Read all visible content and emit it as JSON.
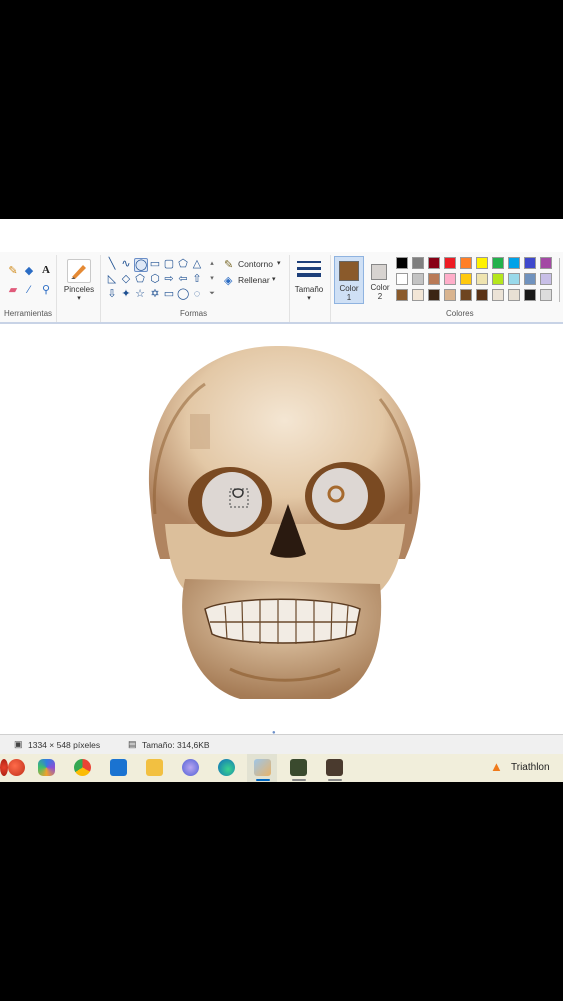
{
  "ribbon": {
    "groups": {
      "tools": "Herramientas",
      "shapes": "Formas",
      "colors": "Colores"
    },
    "brushes_label": "Pinceles",
    "outline_label": "Contorno",
    "fill_label": "Rellenar",
    "size_label": "Tamaño",
    "color1_label": "Color",
    "color1_num": "1",
    "color2_label": "Color",
    "color2_num": "2",
    "text_tool": "A",
    "color1_value": "#8a5a2b",
    "color2_value": "#d7d3d0"
  },
  "palette": {
    "row1": [
      "#000000",
      "#7f7f7f",
      "#880015",
      "#ed1c24",
      "#ff7f27",
      "#fff200",
      "#22b14c",
      "#00a2e8",
      "#3f48cc",
      "#a349a4"
    ],
    "row2": [
      "#ffffff",
      "#c3c3c3",
      "#b97a57",
      "#ffaec9",
      "#ffc90e",
      "#efe4b0",
      "#b5e61d",
      "#99d9ea",
      "#7092be",
      "#c8bfe7"
    ],
    "row3": [
      "#8a5a2b",
      "#f3e6d6",
      "#3b2414",
      "#d9b48f",
      "#6e4520",
      "#5a3215",
      "#ece3d6",
      "#e8e0d4",
      "#1a1a1a",
      "#dcdcdc"
    ]
  },
  "status": {
    "dimensions": "1334 × 548 píxeles",
    "file_size": "Tamaño: 314,6KB"
  },
  "taskbar": {
    "weather_label": "Triathlon"
  }
}
